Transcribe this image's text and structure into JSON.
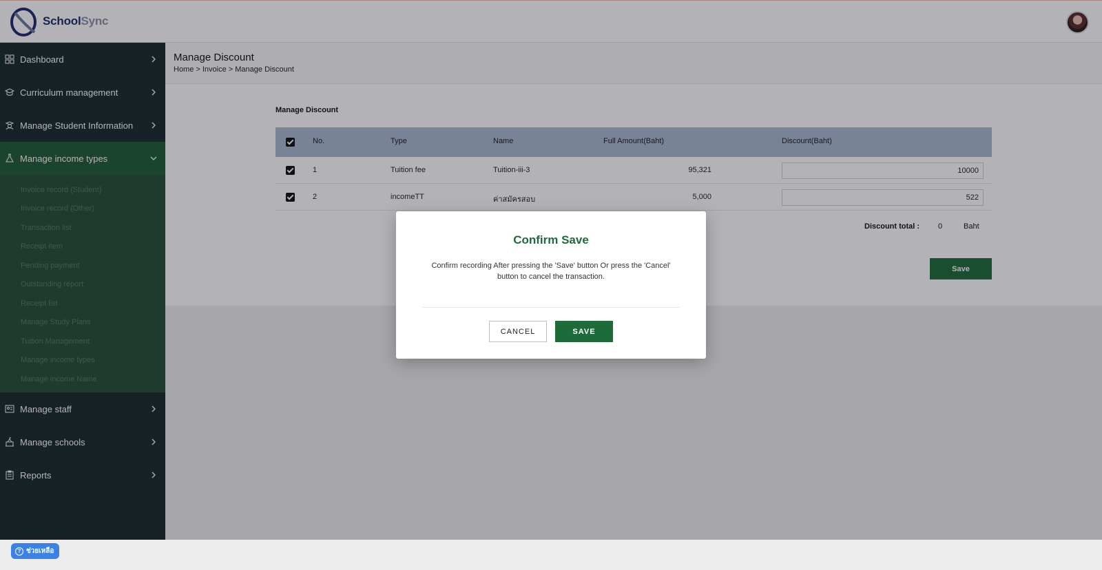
{
  "brand": {
    "name_part1": "School",
    "name_part2": "Sync"
  },
  "sidebar": {
    "items": [
      {
        "label": "Dashboard",
        "icon": "dashboard-icon"
      },
      {
        "label": "Curriculum management",
        "icon": "graduation-cap-icon"
      },
      {
        "label": "Manage Student Information",
        "icon": "student-icon"
      },
      {
        "label": "Manage income types",
        "icon": "flask-icon"
      },
      {
        "label": "Manage staff",
        "icon": "id-card-icon"
      },
      {
        "label": "Manage schools",
        "icon": "school-icon"
      },
      {
        "label": "Reports",
        "icon": "clipboard-icon"
      }
    ],
    "submenu": [
      "Invoice record (Student)",
      "Invoice record (Other)",
      "Transaction list",
      "Receipt item",
      "Pending payment",
      "Outstanding report",
      "Receipt list",
      "Manage Study Plans",
      "Tuition Management",
      "Manage income types",
      "Manage income Name"
    ]
  },
  "header": {
    "title": "Manage Discount",
    "breadcrumb": "Home > Invoice > Manage Discount"
  },
  "main": {
    "section_title": "Manage Discount",
    "columns": [
      "No.",
      "Type",
      "Name",
      "Full Amount(Baht)",
      "Discount(Baht)"
    ],
    "rows": [
      {
        "no": "1",
        "type": "Tuition fee",
        "name": "Tuition-iii-3",
        "full_amount": "95,321",
        "discount": "10000",
        "checked": true
      },
      {
        "no": "2",
        "type": "incomeTT",
        "name": "ค่าสมัครสอบ",
        "full_amount": "5,000",
        "discount": "522",
        "checked": true
      }
    ],
    "discount_total_label": "Discount total :",
    "discount_total_value": "0",
    "discount_total_unit": "Baht",
    "save_label": "Save"
  },
  "modal": {
    "title": "Confirm Save",
    "message": "Confirm recording After pressing the 'Save' button Or press the 'Cancel' button to cancel the transaction.",
    "cancel_label": "CANCEL",
    "save_label": "SAVE"
  },
  "help": {
    "label": "ช่วยเหลือ"
  },
  "colors": {
    "accent": "#1e6b3a",
    "sidebar": "#1a2a2a",
    "active": "#1e5c34",
    "help": "#3b82e6"
  }
}
